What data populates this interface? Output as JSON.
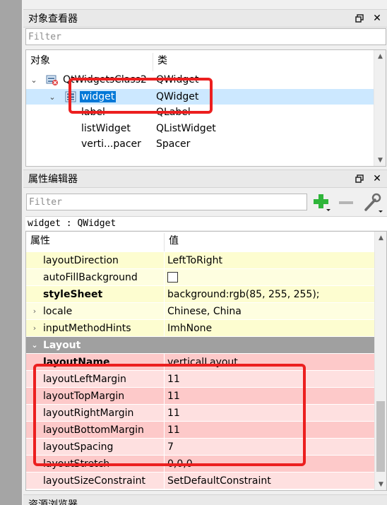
{
  "object_inspector": {
    "title": "对象查看器",
    "filter_placeholder": "Filter",
    "col_object": "对象",
    "col_class": "类",
    "rows": [
      {
        "name": "QtWidgetsClass2",
        "class": "QWidget"
      },
      {
        "name": "widget",
        "class": "QWidget"
      },
      {
        "name": "label",
        "class": "QLabel"
      },
      {
        "name": "listWidget",
        "class": "QListWidget"
      },
      {
        "name": "verti...pacer",
        "class": "Spacer"
      }
    ]
  },
  "property_editor": {
    "title": "属性编辑器",
    "filter_placeholder": "Filter",
    "class_line": "widget : QWidget",
    "col_property": "属性",
    "col_value": "值",
    "rows": [
      {
        "name": "layoutDirection",
        "value": "LeftToRight"
      },
      {
        "name": "autoFillBackground",
        "value": ""
      },
      {
        "name": "styleSheet",
        "value": "background:rgb(85, 255, 255);"
      },
      {
        "name": "locale",
        "value": "Chinese, China"
      },
      {
        "name": "inputMethodHints",
        "value": "ImhNone"
      },
      {
        "name": "Layout",
        "value": ""
      },
      {
        "name": "layoutName",
        "value": "verticalLayout"
      },
      {
        "name": "layoutLeftMargin",
        "value": "11"
      },
      {
        "name": "layoutTopMargin",
        "value": "11"
      },
      {
        "name": "layoutRightMargin",
        "value": "11"
      },
      {
        "name": "layoutBottomMargin",
        "value": "11"
      },
      {
        "name": "layoutSpacing",
        "value": "7"
      },
      {
        "name": "layoutStretch",
        "value": "0,0,0"
      },
      {
        "name": "layoutSizeConstraint",
        "value": "SetDefaultConstraint"
      }
    ]
  },
  "resource_browser": {
    "title": "资源浏览器"
  },
  "icons": {
    "float": "float-icon",
    "close": "close-icon",
    "add": "plus-icon",
    "remove": "minus-icon",
    "configure": "wrench-icon"
  },
  "colors": {
    "selection": "#0078d7",
    "highlight_box": "#ec1f1f",
    "group_header": "#a0a0a0"
  }
}
